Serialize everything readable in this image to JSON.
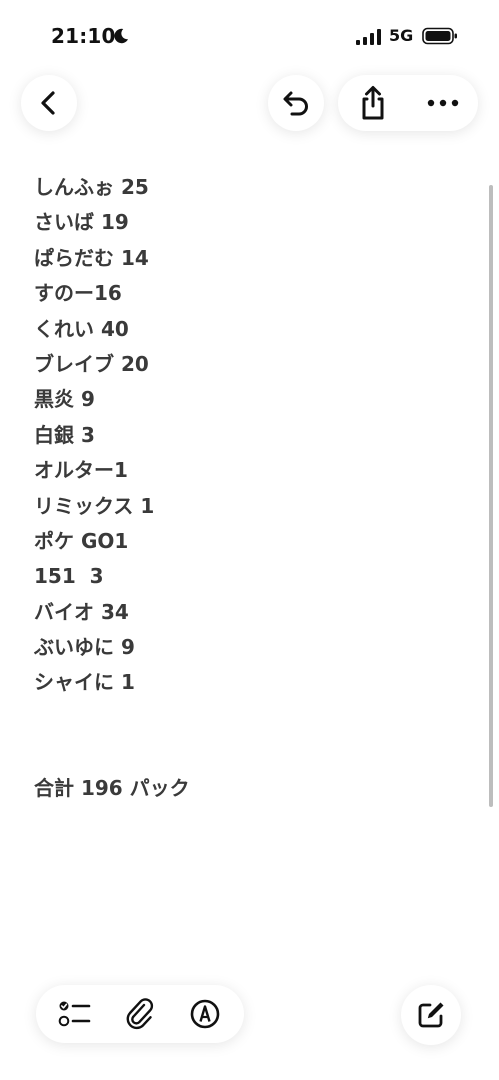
{
  "status_bar": {
    "time": "21:10",
    "network": "5G",
    "icons": [
      "moon-icon",
      "signal-icon",
      "battery-icon"
    ]
  },
  "nav": {
    "icons": [
      "back-chevron-icon",
      "undo-icon",
      "share-icon",
      "more-icon"
    ]
  },
  "note": {
    "lines": [
      "しんふぉ 25",
      "さいば 19",
      "ぱらだむ 14",
      "すのー16",
      "くれい 40",
      "ブレイブ 20",
      "黒炎 9",
      "白銀 3",
      "オルター1",
      "リミックス 1",
      "ポケ GO1",
      "151  3",
      "バイオ 34",
      "ぶいゆに 9",
      "シャイに 1"
    ],
    "total": "合計 196 パック"
  },
  "toolbar": {
    "icons": [
      "checklist-icon",
      "paperclip-icon",
      "markup-pen-icon",
      "compose-icon"
    ]
  },
  "colors": {
    "text": "#3a3a3a",
    "icon": "#1a1a1a",
    "background": "#ffffff"
  }
}
